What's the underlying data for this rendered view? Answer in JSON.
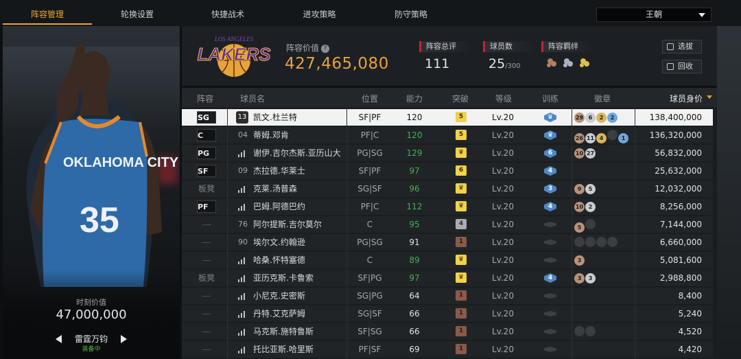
{
  "top_tabs": [
    "阵容管理",
    "轮换设置",
    "快捷战术",
    "进攻策略",
    "防守策略"
  ],
  "active_tab": 0,
  "team_dropdown": "王朝",
  "player_card": {
    "jersey_team": "OKLAHOMA CITY",
    "jersey_number": "35",
    "value_label": "时刻价值",
    "value": "47,000,000",
    "skill_name": "雷霆万钧",
    "skill_status": "装备中"
  },
  "team_header": {
    "logo_text": "LAKERS",
    "logo_subtext": "LOS ANGELES",
    "lineup_value_label": "阵容价值",
    "lineup_value": "427,465,080",
    "overall_label": "阵容总评",
    "overall_value": "111",
    "player_count_label": "球员数",
    "player_count_value": "25",
    "player_count_max": "/300",
    "chemistry_label": "阵容羁绊",
    "scout_button": "选拔",
    "recycle_button": "回收"
  },
  "columns": [
    "阵容",
    "球员名",
    "位置",
    "能力",
    "突破",
    "等级",
    "训练",
    "徽章",
    "球员身价"
  ],
  "players": [
    {
      "slot": "SG",
      "num": "13",
      "name": "凯文.杜兰特",
      "pos": "SF|PF",
      "ability": "120",
      "ability_color": "white",
      "break": "5",
      "break_type": "y",
      "level": "Lv.20",
      "train": "crown",
      "badges": [
        [
          "29",
          "br"
        ],
        [
          "6",
          "si"
        ],
        [
          "2",
          "go"
        ],
        [
          "2",
          "bl"
        ]
      ],
      "price": "138,400,000",
      "selected": true
    },
    {
      "slot": "C",
      "num": "04",
      "name": "蒂姆.邓肯",
      "pos": "PF|C",
      "ability": "120",
      "ability_color": "green",
      "break": "5",
      "break_type": "y",
      "level": "Lv.20",
      "train": "crown",
      "badges": [
        [
          "26",
          "br"
        ],
        [
          "11",
          "si"
        ],
        [
          "4",
          "go"
        ],
        [
          "",
          "dk"
        ],
        [
          "1",
          "bl"
        ]
      ],
      "price": "136,320,000"
    },
    {
      "slot": "PG",
      "num": "bars",
      "name": "谢伊.吉尔杰斯.亚历山大",
      "pos": "PG|SG",
      "ability": "129",
      "ability_color": "green",
      "break": "crown",
      "break_type": "y",
      "level": "Lv.20",
      "train": "6",
      "badges": [
        [
          "10",
          "br"
        ],
        [
          "27",
          "si"
        ]
      ],
      "price": "56,832,000"
    },
    {
      "slot": "SF",
      "num": "09",
      "name": "杰拉德.华莱士",
      "pos": "SF|PF",
      "ability": "97",
      "ability_color": "green",
      "break": "6",
      "break_type": "y",
      "level": "Lv.20",
      "train": "4",
      "badges": [],
      "price": "25,632,000"
    },
    {
      "slot": "板凳",
      "num": "bars",
      "name": "克莱.汤普森",
      "pos": "SG|SF",
      "ability": "96",
      "ability_color": "green",
      "break": "crown",
      "break_type": "y",
      "level": "Lv.20",
      "train": "3",
      "badges": [
        [
          "9",
          "br"
        ],
        [
          "5",
          "si"
        ]
      ],
      "price": "12,032,000"
    },
    {
      "slot": "PF",
      "num": "bars",
      "name": "巴姆.阿德巴约",
      "pos": "PF|C",
      "ability": "112",
      "ability_color": "green",
      "break": "crown",
      "break_type": "y",
      "level": "Lv.20",
      "train": "4",
      "badges": [
        [
          "10",
          "br"
        ],
        [
          "2",
          "si"
        ]
      ],
      "price": "8,256,000"
    },
    {
      "slot": "---",
      "num": "76",
      "name": "阿尔提斯.吉尔莫尔",
      "pos": "C",
      "ability": "95",
      "ability_color": "green",
      "break": "4",
      "break_type": "g",
      "level": "Lv.20",
      "train": "dark",
      "badges": [
        [
          "5",
          "br"
        ],
        [
          "",
          "dk"
        ]
      ],
      "price": "7,144,000"
    },
    {
      "slot": "---",
      "num": "90",
      "name": "埃尔文.约翰逊",
      "pos": "PG|SG",
      "ability": "91",
      "ability_color": "white",
      "break": "1",
      "break_type": "b",
      "level": "Lv.20",
      "train": "dark",
      "badges": [
        [
          "",
          "dk"
        ],
        [
          "",
          "dk"
        ],
        [
          "",
          "dk"
        ],
        [
          "",
          "dk"
        ]
      ],
      "price": "6,660,000"
    },
    {
      "slot": "---",
      "num": "bars",
      "name": "哈桑.怀特塞德",
      "pos": "C",
      "ability": "89",
      "ability_color": "green",
      "break": "crown",
      "break_type": "y",
      "level": "Lv.20",
      "train": "dark",
      "badges": [
        [
          "3",
          "br"
        ]
      ],
      "price": "5,081,600"
    },
    {
      "slot": "板凳",
      "num": "bars",
      "name": "亚历克斯.卡鲁索",
      "pos": "SF|PG",
      "ability": "97",
      "ability_color": "green",
      "break": "crown",
      "break_type": "y",
      "level": "Lv.20",
      "train": "4",
      "badges": [
        [
          "3",
          "br"
        ],
        [
          "3",
          "si"
        ]
      ],
      "price": "2,988,800"
    },
    {
      "slot": "---",
      "num": "bars",
      "name": "小尼克.史密斯",
      "pos": "SG|PG",
      "ability": "64",
      "ability_color": "white",
      "break": "1",
      "break_type": "b",
      "level": "Lv.20",
      "train": "dark",
      "badges": [],
      "price": "8,400"
    },
    {
      "slot": "---",
      "num": "bars",
      "name": "丹特.艾克萨姆",
      "pos": "SG|SF",
      "ability": "66",
      "ability_color": "white",
      "break": "1",
      "break_type": "b",
      "level": "Lv.20",
      "train": "dark",
      "badges": [],
      "price": "5,240"
    },
    {
      "slot": "---",
      "num": "bars",
      "name": "马克斯.施特鲁斯",
      "pos": "SF|SG",
      "ability": "66",
      "ability_color": "white",
      "break": "1",
      "break_type": "b",
      "level": "Lv.20",
      "train": "dark",
      "badges": [
        [
          "",
          "dk"
        ],
        [
          "",
          "dk"
        ]
      ],
      "price": "4,520"
    },
    {
      "slot": "---",
      "num": "bars",
      "name": "托比亚斯.哈里斯",
      "pos": "PF|SF",
      "ability": "69",
      "ability_color": "white",
      "break": "1",
      "break_type": "b",
      "level": "Lv.20",
      "train": "dark",
      "badges": [],
      "price": "4,420"
    }
  ]
}
